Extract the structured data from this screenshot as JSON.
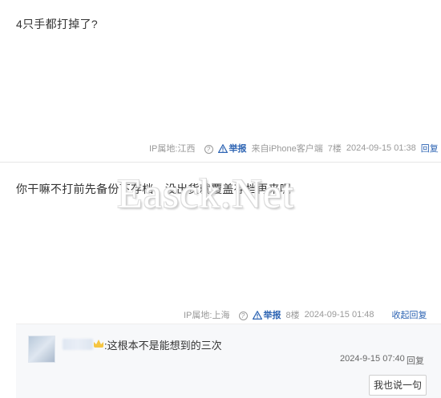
{
  "post1": {
    "content": "4只手都打掉了?",
    "ip_label": "IP属地:江西",
    "report": "举报",
    "source": "来自iPhone客户端",
    "floor": "7楼",
    "time": "2024-09-15 01:38",
    "reply": "回复"
  },
  "post2": {
    "content": "你干嘛不打前先备份下存档，没出货就覆盖存档再来呢",
    "ip_label": "IP属地:上海",
    "report": "举报",
    "floor": "8楼",
    "time": "2024-09-15 01:48",
    "collapse": "收起回复"
  },
  "watermark": "Easck.Net",
  "comment": {
    "text": ":这根本不是能想到的三次",
    "time": "2024-9-15 07:40",
    "reply": "回复",
    "button": "我也说一句"
  },
  "icons": {
    "question": "question-circle-icon",
    "warning": "warning-triangle-icon",
    "vip": "vip-crown-icon"
  },
  "colors": {
    "link": "#2d64b3",
    "meta": "#999999",
    "comment_bg": "#f7f8fa"
  }
}
